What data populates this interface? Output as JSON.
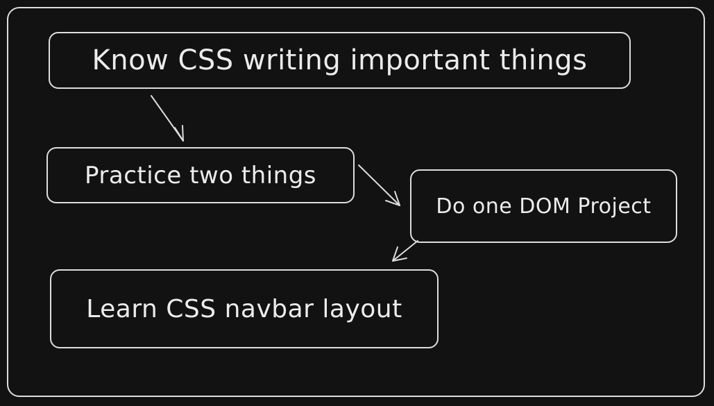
{
  "diagram": {
    "nodes": [
      {
        "id": "n1",
        "label": "Know CSS writing important things"
      },
      {
        "id": "n2",
        "label": "Practice two things"
      },
      {
        "id": "n3",
        "label": "Do one DOM Project"
      },
      {
        "id": "n4",
        "label": "Learn CSS navbar layout"
      }
    ],
    "edges": [
      {
        "from": "n1",
        "to": "n2"
      },
      {
        "from": "n2",
        "to": "n3"
      },
      {
        "from": "n3",
        "to": "n4"
      }
    ],
    "colors": {
      "background": "#121212",
      "stroke": "#dedede",
      "text": "#ececec"
    }
  }
}
